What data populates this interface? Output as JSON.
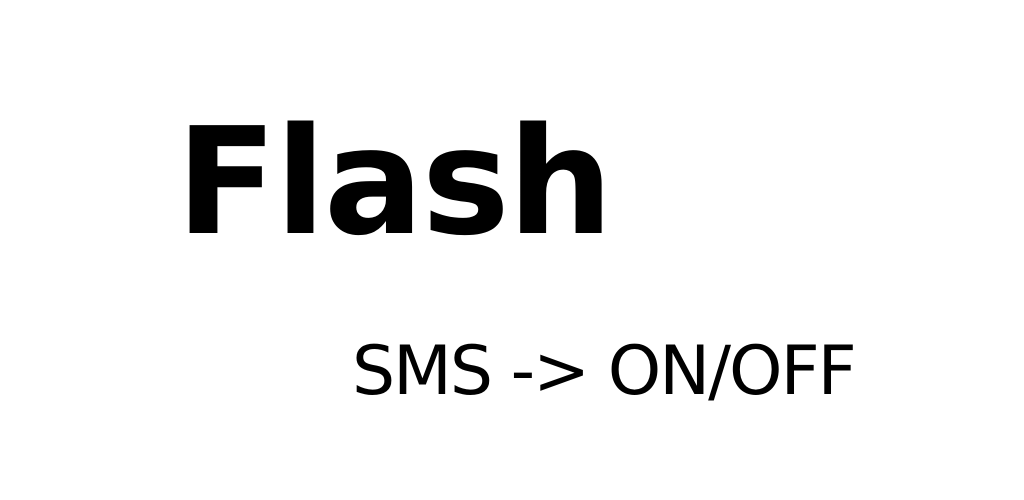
{
  "banner": {
    "title": "Flash",
    "subtitle": "SMS -> ON/OFF"
  },
  "colors": {
    "background": "#ffffff",
    "text": "#000000"
  }
}
